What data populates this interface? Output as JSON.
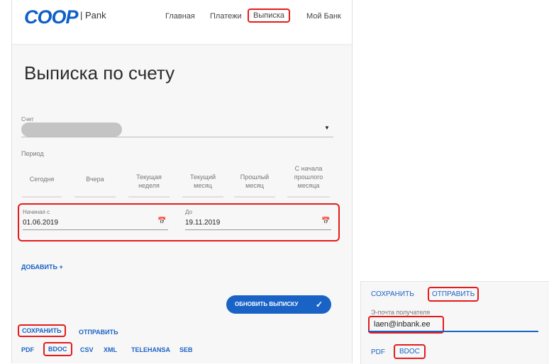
{
  "header": {
    "logo": "COOP",
    "logo_suffix": "| Pank",
    "nav": [
      "Главная",
      "Платежи",
      "Выписка",
      "Мой Банк"
    ],
    "active_nav": "Выписка"
  },
  "main": {
    "title": "Выписка по счету",
    "account_label": "Счет",
    "period_label": "Период",
    "periods": [
      "Сегодня",
      "Вчера",
      "Текущая неделя",
      "Текущий месяц",
      "Прошлый месяц",
      "С начала прошлого месяца"
    ],
    "from_label": "Начиная с",
    "from_value": "01.06.2019",
    "to_label": "До",
    "to_value": "19.11.2019",
    "add_label": "ДОБАВИТЬ +",
    "refresh_label": "ОБНОВИТЬ ВЫПИСКУ",
    "save_label": "СОХРАНИТЬ",
    "send_label": "ОТПРАВИТЬ",
    "formats": [
      "PDF",
      "BDOC",
      "CSV",
      "XML",
      "TELEHANSA",
      "SEB"
    ]
  },
  "side": {
    "save_label": "СОХРАНИТЬ",
    "send_label": "ОТПРАВИТЬ",
    "email_label": "Э-почта получателя",
    "email_value": "laen@inbank.ee",
    "formats": [
      "PDF",
      "BDOC"
    ]
  },
  "colors": {
    "accent": "#1a63c6",
    "highlight": "#e51b1b"
  }
}
